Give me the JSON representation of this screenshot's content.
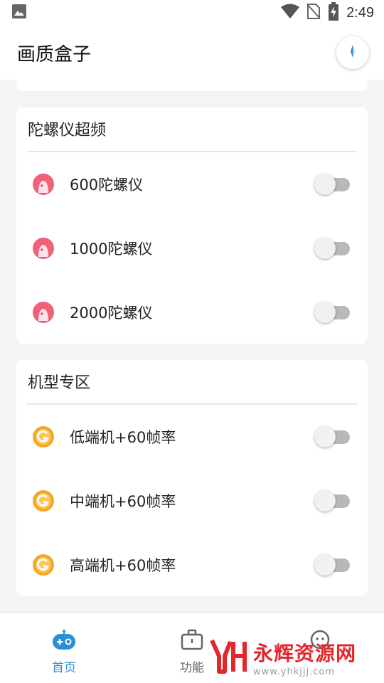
{
  "status_bar": {
    "time": "2:49",
    "icons": [
      "image-icon",
      "wifi-icon",
      "no-sim-icon",
      "battery-charging-icon"
    ]
  },
  "app_bar": {
    "title": "画质盒子",
    "action_icon": "compass-icon"
  },
  "sections": [
    {
      "title": "陀螺仪超频",
      "items": [
        {
          "label": "600陀螺仪",
          "icon": "pink-ghost-icon",
          "enabled": false
        },
        {
          "label": "1000陀螺仪",
          "icon": "pink-ghost-icon",
          "enabled": false
        },
        {
          "label": "2000陀螺仪",
          "icon": "pink-ghost-icon",
          "enabled": false
        }
      ]
    },
    {
      "title": "机型专区",
      "items": [
        {
          "label": "低端机+60帧率",
          "icon": "orange-g-icon",
          "enabled": false
        },
        {
          "label": "中端机+60帧率",
          "icon": "orange-g-icon",
          "enabled": false
        },
        {
          "label": "高端机+60帧率",
          "icon": "orange-g-icon",
          "enabled": false
        }
      ]
    }
  ],
  "bottom_nav": {
    "items": [
      {
        "label": "首页",
        "icon": "gamepad-icon",
        "active": true
      },
      {
        "label": "功能",
        "icon": "briefcase-icon",
        "active": false
      },
      {
        "label": "",
        "icon": "chat-face-icon",
        "active": false
      }
    ]
  },
  "watermark": {
    "mark": "YH",
    "title": "永辉资源网",
    "url": "www.yhkjjj.com"
  },
  "colors": {
    "accent": "#2b8fd6",
    "toggle_off_track": "#b8b8b8",
    "pink_icon": "#f0607a",
    "orange_icon": "#f5a623",
    "watermark_red": "#e5262d"
  }
}
